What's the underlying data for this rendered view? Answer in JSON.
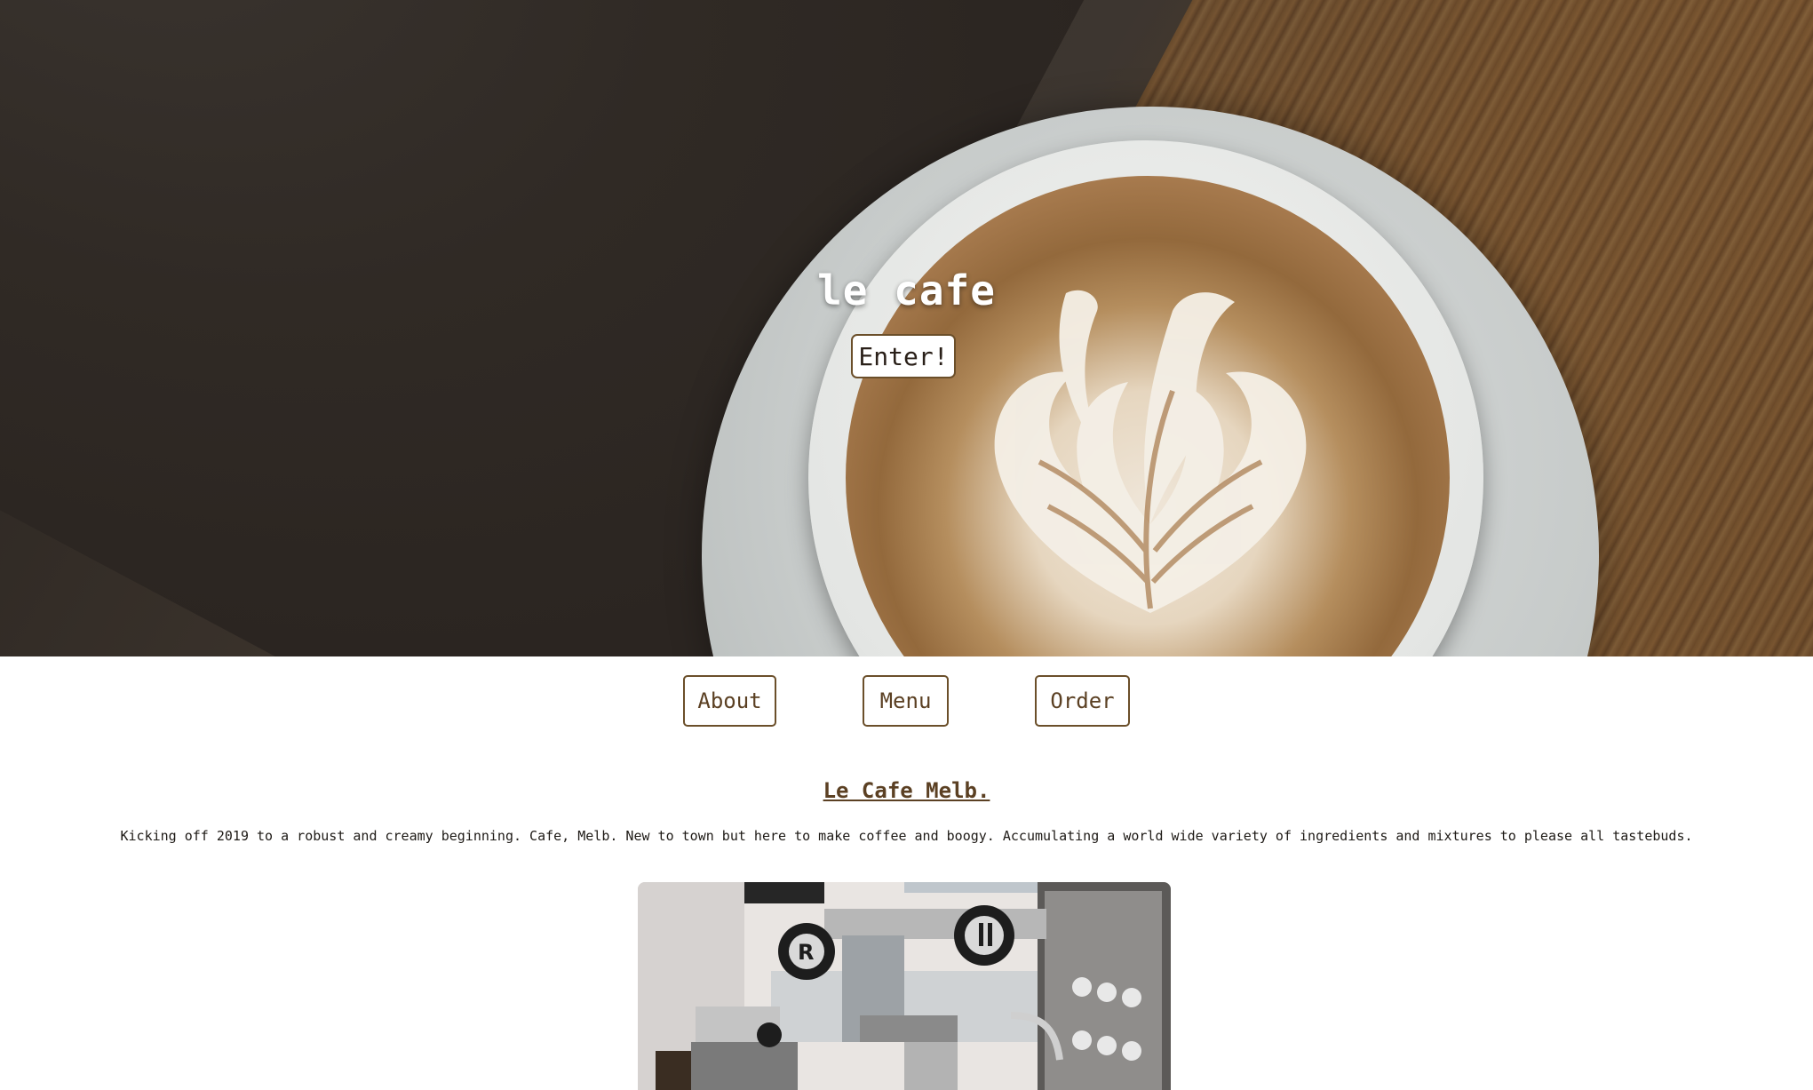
{
  "hero": {
    "brand": "le cafe",
    "enter_label": "Enter!"
  },
  "nav": {
    "about_label": "About",
    "menu_label": "Menu",
    "order_label": "Order"
  },
  "about": {
    "title": "Le Cafe Melb.",
    "text": "Kicking off 2019 to a robust and creamy beginning. Cafe, Melb. New to town but here to make coffee and boogy. Accumulating a world wide variety of ingredients and mixtures to please all tastebuds."
  },
  "colors": {
    "accent": "#6b4f2a",
    "nav_text": "#5b4023",
    "hero_text": "#ffffff"
  }
}
